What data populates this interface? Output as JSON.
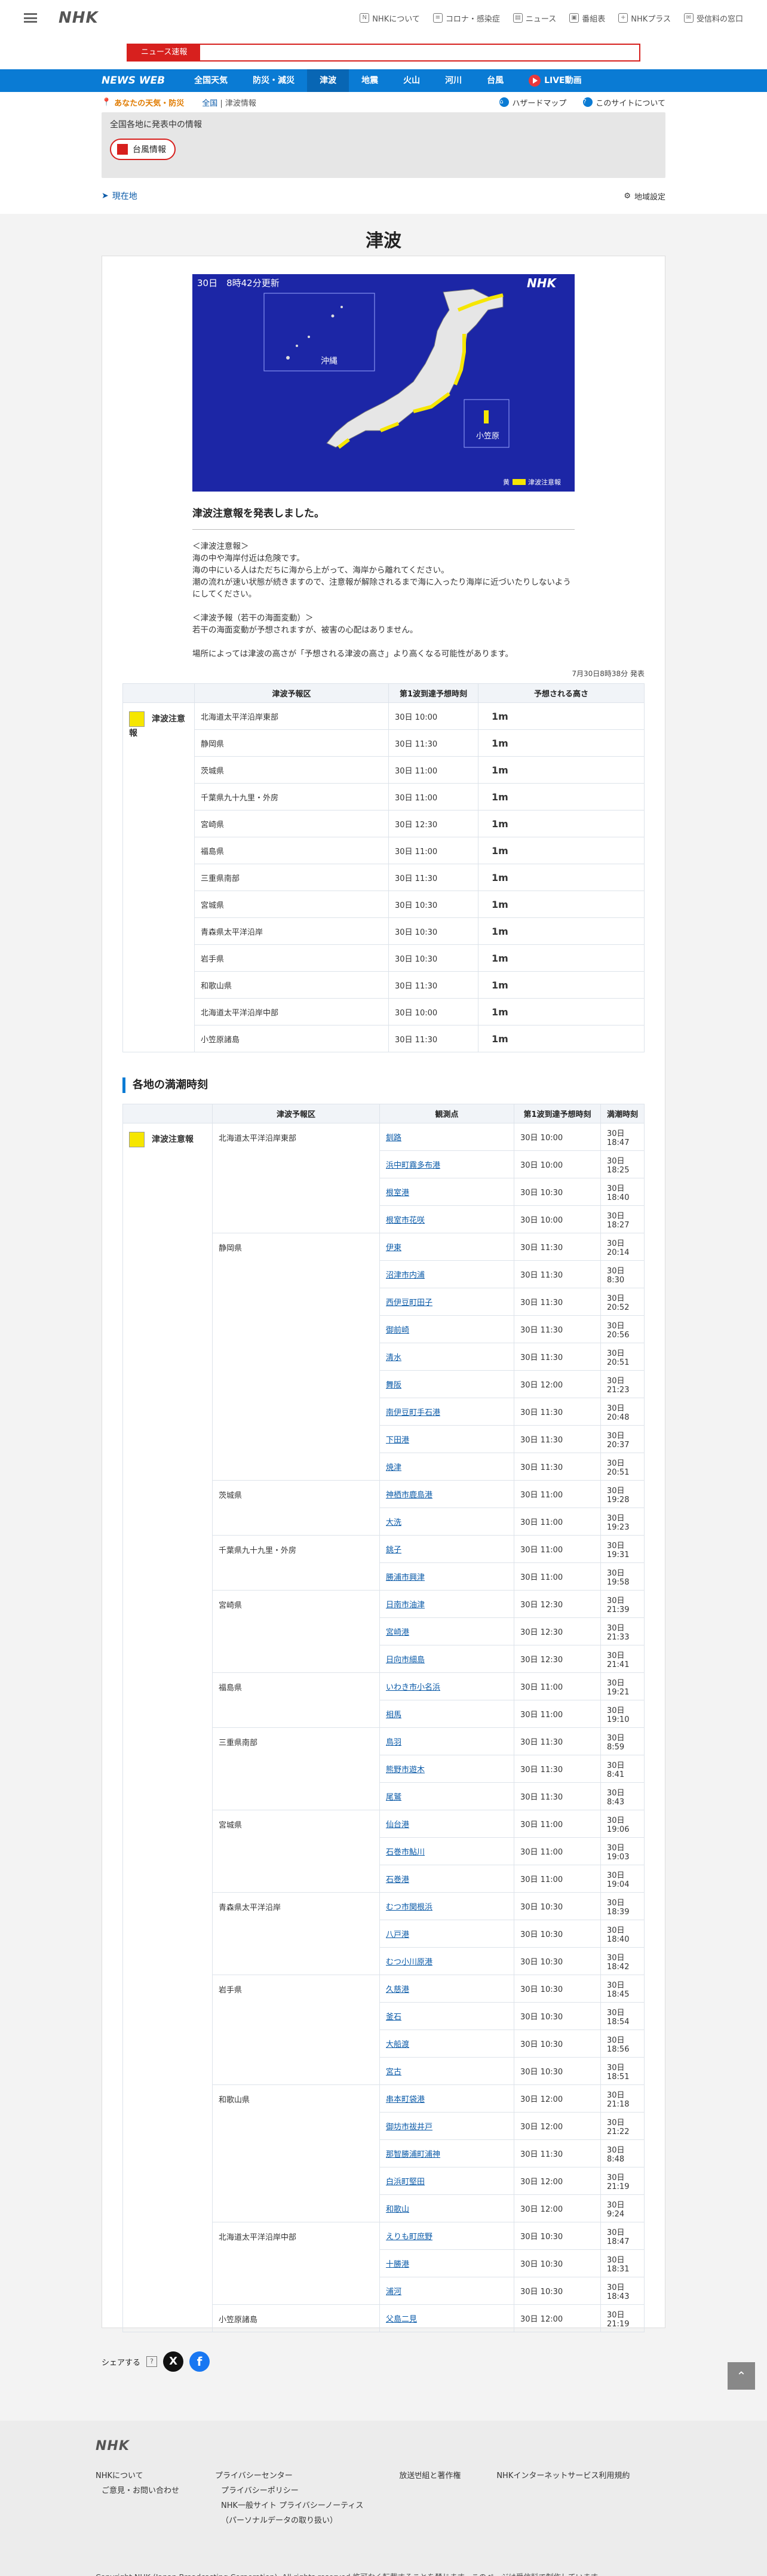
{
  "header": {
    "logo": "NHK",
    "links": [
      {
        "icon": "nhk-icon",
        "label": "NHKについて"
      },
      {
        "icon": "document-icon",
        "label": "コロナ・感染症"
      },
      {
        "icon": "news-icon",
        "label": "ニュース"
      },
      {
        "icon": "tv-icon",
        "label": "番組表"
      },
      {
        "icon": "plus-icon",
        "label": "NHKプラス"
      },
      {
        "icon": "mail-icon",
        "label": "受信料の窓口"
      }
    ],
    "breaking_label": "ニュース速報"
  },
  "nav": {
    "brand": "NEWS WEB",
    "items": [
      "全国天気",
      "防災・減災",
      "津波",
      "地震",
      "火山",
      "河川",
      "台風"
    ],
    "live": "LIVE動画"
  },
  "subbar": {
    "weather": "あなたの天気・防災",
    "crumb_home": "全国",
    "crumb_sep": " | ",
    "crumb_current": "津波情報",
    "hazard": "ハザードマップ",
    "about": "このサイトについて"
  },
  "alert_panel": {
    "title": "全国各地に発表中の情報",
    "chip": "台風情報"
  },
  "location": {
    "current": "現在地",
    "settings": "地域設定"
  },
  "page_title": "津波",
  "map": {
    "stamp": "30日　8時42分更新",
    "okinawa": "沖縄",
    "ogasawara": "小笠原",
    "brand": "NHK",
    "legend_label": "黄",
    "legend_text": "津波注意報"
  },
  "announcement": "津波注意報を発表しました。",
  "body_text": "＜津波注意報＞\n海の中や海岸付近は危険です。\n海の中にいる人はただちに海から上がって、海岸から離れてください。\n潮の流れが速い状態が続きますので、注意報が解除されるまで海に入ったり海岸に近づいたりしないようにしてください。\n\n＜津波予報（若干の海面変動）＞\n若干の海面変動が予想されますが、被害の心配はありません。\n\n場所によっては津波の高さが「予想される津波の高さ」より高くなる可能性があります。",
  "issued_stamp": "7月30日8時38分 発表",
  "table1": {
    "headers": [
      "",
      "津波予報区",
      "第1波到達予想時刻",
      "予想される高さ"
    ],
    "warning_label": "津波注意報",
    "rows": [
      {
        "area": "北海道太平洋沿岸東部",
        "time": "30日 10:00",
        "height": "1m"
      },
      {
        "area": "静岡県",
        "time": "30日 11:30",
        "height": "1m"
      },
      {
        "area": "茨城県",
        "time": "30日 11:00",
        "height": "1m"
      },
      {
        "area": "千葉県九十九里・外房",
        "time": "30日 11:00",
        "height": "1m"
      },
      {
        "area": "宮崎県",
        "time": "30日 12:30",
        "height": "1m"
      },
      {
        "area": "福島県",
        "time": "30日 11:00",
        "height": "1m"
      },
      {
        "area": "三重県南部",
        "time": "30日 11:30",
        "height": "1m"
      },
      {
        "area": "宮城県",
        "time": "30日 10:30",
        "height": "1m"
      },
      {
        "area": "青森県太平洋沿岸",
        "time": "30日 10:30",
        "height": "1m"
      },
      {
        "area": "岩手県",
        "time": "30日 10:30",
        "height": "1m"
      },
      {
        "area": "和歌山県",
        "time": "30日 11:30",
        "height": "1m"
      },
      {
        "area": "北海道太平洋沿岸中部",
        "time": "30日 10:00",
        "height": "1m"
      },
      {
        "area": "小笠原諸島",
        "time": "30日 11:30",
        "height": "1m"
      }
    ]
  },
  "section2_title": "各地の満潮時刻",
  "table2": {
    "headers": [
      "",
      "津波予報区",
      "観測点",
      "第1波到達予想時刻",
      "満潮時刻"
    ],
    "warning_label": "津波注意報",
    "groups": [
      {
        "area": "北海道太平洋沿岸東部",
        "points": [
          {
            "name": "釧路",
            "time": "30日 10:00",
            "tide": "30日 18:47"
          },
          {
            "name": "浜中町霧多布港",
            "time": "30日 10:00",
            "tide": "30日 18:25"
          },
          {
            "name": "根室港",
            "time": "30日 10:30",
            "tide": "30日 18:40"
          },
          {
            "name": "根室市花咲",
            "time": "30日 10:00",
            "tide": "30日 18:27"
          }
        ]
      },
      {
        "area": "静岡県",
        "points": [
          {
            "name": "伊東",
            "time": "30日 11:30",
            "tide": "30日 20:14"
          },
          {
            "name": "沼津市内浦",
            "time": "30日 11:30",
            "tide": "30日 8:30"
          },
          {
            "name": "西伊豆町田子",
            "time": "30日 11:30",
            "tide": "30日 20:52"
          },
          {
            "name": "御前崎",
            "time": "30日 11:30",
            "tide": "30日 20:56"
          },
          {
            "name": "清水",
            "time": "30日 11:30",
            "tide": "30日 20:51"
          },
          {
            "name": "舞阪",
            "time": "30日 12:00",
            "tide": "30日 21:23"
          },
          {
            "name": "南伊豆町手石港",
            "time": "30日 11:30",
            "tide": "30日 20:48"
          },
          {
            "name": "下田港",
            "time": "30日 11:30",
            "tide": "30日 20:37"
          },
          {
            "name": "焼津",
            "time": "30日 11:30",
            "tide": "30日 20:51"
          }
        ]
      },
      {
        "area": "茨城県",
        "points": [
          {
            "name": "神栖市鹿島港",
            "time": "30日 11:00",
            "tide": "30日 19:28"
          },
          {
            "name": "大洗",
            "time": "30日 11:00",
            "tide": "30日 19:23"
          }
        ]
      },
      {
        "area": "千葉県九十九里・外房",
        "points": [
          {
            "name": "銚子",
            "time": "30日 11:00",
            "tide": "30日 19:31"
          },
          {
            "name": "勝浦市興津",
            "time": "30日 11:00",
            "tide": "30日 19:58"
          }
        ]
      },
      {
        "area": "宮崎県",
        "points": [
          {
            "name": "日南市油津",
            "time": "30日 12:30",
            "tide": "30日 21:39"
          },
          {
            "name": "宮崎港",
            "time": "30日 12:30",
            "tide": "30日 21:33"
          },
          {
            "name": "日向市細島",
            "time": "30日 12:30",
            "tide": "30日 21:41"
          }
        ]
      },
      {
        "area": "福島県",
        "points": [
          {
            "name": "いわき市小名浜",
            "time": "30日 11:00",
            "tide": "30日 19:21"
          },
          {
            "name": "相馬",
            "time": "30日 11:00",
            "tide": "30日 19:10"
          }
        ]
      },
      {
        "area": "三重県南部",
        "points": [
          {
            "name": "鳥羽",
            "time": "30日 11:30",
            "tide": "30日 8:59"
          },
          {
            "name": "熊野市遊木",
            "time": "30日 11:30",
            "tide": "30日 8:41"
          },
          {
            "name": "尾鷲",
            "time": "30日 11:30",
            "tide": "30日 8:43"
          }
        ]
      },
      {
        "area": "宮城県",
        "points": [
          {
            "name": "仙台港",
            "time": "30日 11:00",
            "tide": "30日 19:06"
          },
          {
            "name": "石巻市鮎川",
            "time": "30日 11:00",
            "tide": "30日 19:03"
          },
          {
            "name": "石巻港",
            "time": "30日 11:00",
            "tide": "30日 19:04"
          }
        ]
      },
      {
        "area": "青森県太平洋沿岸",
        "points": [
          {
            "name": "むつ市関根浜",
            "time": "30日 10:30",
            "tide": "30日 18:39"
          },
          {
            "name": "八戸港",
            "time": "30日 10:30",
            "tide": "30日 18:40"
          },
          {
            "name": "むつ小川原港",
            "time": "30日 10:30",
            "tide": "30日 18:42"
          }
        ]
      },
      {
        "area": "岩手県",
        "points": [
          {
            "name": "久慈港",
            "time": "30日 10:30",
            "tide": "30日 18:45"
          },
          {
            "name": "釜石",
            "time": "30日 10:30",
            "tide": "30日 18:54"
          },
          {
            "name": "大船渡",
            "time": "30日 10:30",
            "tide": "30日 18:56"
          },
          {
            "name": "宮古",
            "time": "30日 10:30",
            "tide": "30日 18:51"
          }
        ]
      },
      {
        "area": "和歌山県",
        "points": [
          {
            "name": "串本町袋港",
            "time": "30日 12:00",
            "tide": "30日 21:18"
          },
          {
            "name": "御坊市祓井戸",
            "time": "30日 12:00",
            "tide": "30日 21:22"
          },
          {
            "name": "那智勝浦町浦神",
            "time": "30日 11:30",
            "tide": "30日 8:48"
          },
          {
            "name": "白浜町堅田",
            "time": "30日 12:00",
            "tide": "30日 21:19"
          },
          {
            "name": "和歌山",
            "time": "30日 12:00",
            "tide": "30日 9:24"
          }
        ]
      },
      {
        "area": "北海道太平洋沿岸中部",
        "points": [
          {
            "name": "えりも町庶野",
            "time": "30日 10:30",
            "tide": "30日 18:47"
          },
          {
            "name": "十勝港",
            "time": "30日 10:30",
            "tide": "30日 18:31"
          },
          {
            "name": "浦河",
            "time": "30日 10:30",
            "tide": "30日 18:43"
          }
        ]
      },
      {
        "area": "小笠原諸島",
        "points": [
          {
            "name": "父島二見",
            "time": "30日 12:00",
            "tide": "30日 21:19"
          }
        ]
      }
    ]
  },
  "share": {
    "label": "シェアする",
    "help": "?",
    "x": "X",
    "fb": "f"
  },
  "totop": "⌃",
  "footer": {
    "logo": "NHK",
    "col1": [
      "NHKについて",
      "ご意見・お問い合わせ"
    ],
    "col2": [
      "プライバシーセンター",
      "プライバシーポリシー",
      "NHK一般サイト プライバシーノーティス",
      "（パーソナルデータの取り扱い）"
    ],
    "col3": [
      "放送번組と著作権"
    ],
    "col4": [
      "NHKインターネットサービス利用規約"
    ],
    "copyright": "Copyright NHK (Japan Broadcasting Corporation). All rights reserved.許可なく転載することを禁じます。このページは受信料で制作しています。"
  },
  "colors": {
    "nav": "#0a7bd4",
    "alert": "#d7201e",
    "warning_yellow": "#f6e600",
    "map_sea": "#1c26a6"
  }
}
